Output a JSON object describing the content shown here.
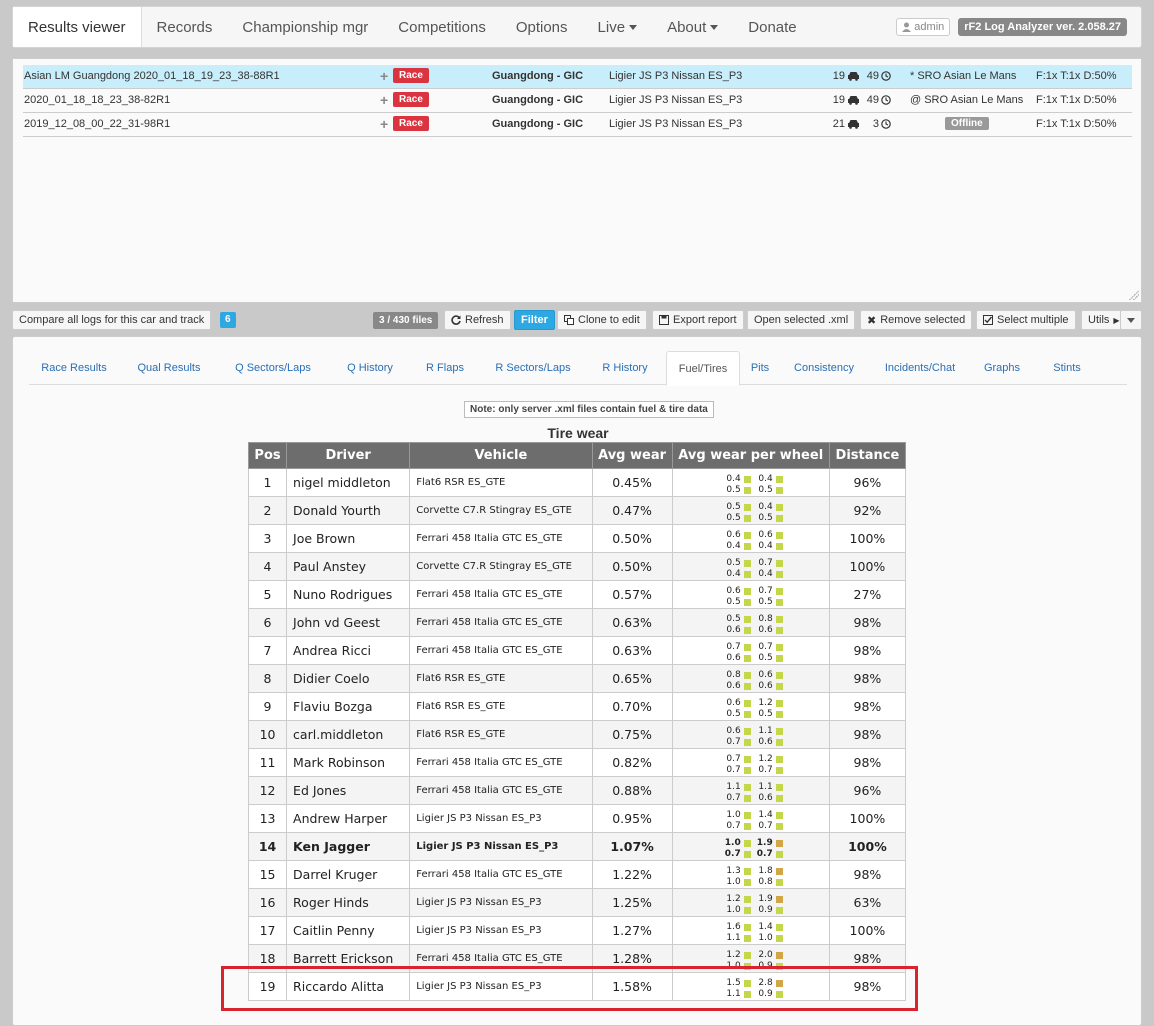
{
  "nav": {
    "items": [
      {
        "label": "Results viewer",
        "active": true
      },
      {
        "label": "Records"
      },
      {
        "label": "Championship mgr"
      },
      {
        "label": "Competitions"
      },
      {
        "label": "Options"
      },
      {
        "label": "Live",
        "dropdown": true
      },
      {
        "label": "About",
        "dropdown": true
      },
      {
        "label": "Donate"
      }
    ],
    "user": "admin",
    "version": "rF2 Log Analyzer ver. 2.058.27"
  },
  "files": [
    {
      "name": "Asian LM Guangdong 2020_01_18_19_23_38-88R1",
      "session": "Race",
      "track": "Guangdong - GIC",
      "car": "Ligier JS P3 Nissan ES_P3",
      "drivers": "19",
      "laps": "49",
      "server": "* SRO Asian Le Mans",
      "flags": "F:1x T:1x D:50%",
      "selected": true
    },
    {
      "name": "2020_01_18_18_23_38-82R1",
      "session": "Race",
      "track": "Guangdong - GIC",
      "car": "Ligier JS P3 Nissan ES_P3",
      "drivers": "19",
      "laps": "49",
      "server": "@ SRO Asian Le Mans",
      "flags": "F:1x T:1x D:50%"
    },
    {
      "name": "2019_12_08_00_22_31-98R1",
      "session": "Race",
      "track": "Guangdong - GIC",
      "car": "Ligier JS P3 Nissan ES_P3",
      "drivers": "21",
      "laps": "3",
      "server": "Offline",
      "flags": "F:1x T:1x D:50%",
      "offline": true
    }
  ],
  "toolbar": {
    "compare": "Compare all logs for this car and track",
    "compare_count": "6",
    "file_count": "3 / 430 files",
    "refresh": "Refresh",
    "filter": "Filter",
    "clone": "Clone to edit",
    "export": "Export report",
    "open_xml": "Open selected .xml",
    "remove": "Remove selected",
    "select_multiple": "Select multiple",
    "utils": "Utils"
  },
  "tabs": [
    {
      "label": "Race Results"
    },
    {
      "label": "Qual Results"
    },
    {
      "label": "Q Sectors/Laps"
    },
    {
      "label": "Q History"
    },
    {
      "label": "R Flaps"
    },
    {
      "label": "R Sectors/Laps"
    },
    {
      "label": "R History"
    },
    {
      "label": "Fuel/Tires",
      "active": true
    },
    {
      "label": "Pits"
    },
    {
      "label": "Consistency"
    },
    {
      "label": "Incidents/Chat"
    },
    {
      "label": "Graphs"
    },
    {
      "label": "Stints"
    }
  ],
  "note": "Note: only server .xml files contain fuel & tire data",
  "table": {
    "title": "Tire wear",
    "headers": [
      "Pos",
      "Driver",
      "Vehicle",
      "Avg wear",
      "Avg wear per wheel",
      "Distance"
    ],
    "rows": [
      {
        "pos": "1",
        "driver": "nigel middleton",
        "vehicle": "Flat6 RSR ES_GTE",
        "avg": "0.45%",
        "w": [
          "0.4",
          "0.4",
          "0.5",
          "0.5"
        ],
        "dist": "96%"
      },
      {
        "pos": "2",
        "driver": "Donald Yourth",
        "vehicle": "Corvette C7.R Stingray ES_GTE",
        "avg": "0.47%",
        "w": [
          "0.5",
          "0.4",
          "0.5",
          "0.5"
        ],
        "dist": "92%"
      },
      {
        "pos": "3",
        "driver": "Joe Brown",
        "vehicle": "Ferrari 458 Italia GTC ES_GTE",
        "avg": "0.50%",
        "w": [
          "0.6",
          "0.6",
          "0.4",
          "0.4"
        ],
        "dist": "100%"
      },
      {
        "pos": "4",
        "driver": "Paul Anstey",
        "vehicle": "Corvette C7.R Stingray ES_GTE",
        "avg": "0.50%",
        "w": [
          "0.5",
          "0.7",
          "0.4",
          "0.4"
        ],
        "dist": "100%"
      },
      {
        "pos": "5",
        "driver": "Nuno Rodrigues",
        "vehicle": "Ferrari 458 Italia GTC ES_GTE",
        "avg": "0.57%",
        "w": [
          "0.6",
          "0.7",
          "0.5",
          "0.5"
        ],
        "dist": "27%"
      },
      {
        "pos": "6",
        "driver": "John vd Geest",
        "vehicle": "Ferrari 458 Italia GTC ES_GTE",
        "avg": "0.63%",
        "w": [
          "0.5",
          "0.8",
          "0.6",
          "0.6"
        ],
        "dist": "98%"
      },
      {
        "pos": "7",
        "driver": "Andrea Ricci",
        "vehicle": "Ferrari 458 Italia GTC ES_GTE",
        "avg": "0.63%",
        "w": [
          "0.7",
          "0.7",
          "0.6",
          "0.5"
        ],
        "dist": "98%"
      },
      {
        "pos": "8",
        "driver": "Didier Coelo",
        "vehicle": "Flat6 RSR ES_GTE",
        "avg": "0.65%",
        "w": [
          "0.8",
          "0.6",
          "0.6",
          "0.6"
        ],
        "dist": "98%"
      },
      {
        "pos": "9",
        "driver": "Flaviu Bozga",
        "vehicle": "Flat6 RSR ES_GTE",
        "avg": "0.70%",
        "w": [
          "0.6",
          "1.2",
          "0.5",
          "0.5"
        ],
        "dist": "98%"
      },
      {
        "pos": "10",
        "driver": "carl.middleton",
        "vehicle": "Flat6 RSR ES_GTE",
        "avg": "0.75%",
        "w": [
          "0.6",
          "1.1",
          "0.7",
          "0.6"
        ],
        "dist": "98%"
      },
      {
        "pos": "11",
        "driver": "Mark Robinson",
        "vehicle": "Ferrari 458 Italia GTC ES_GTE",
        "avg": "0.82%",
        "w": [
          "0.7",
          "1.2",
          "0.7",
          "0.7"
        ],
        "dist": "98%"
      },
      {
        "pos": "12",
        "driver": "Ed Jones",
        "vehicle": "Ferrari 458 Italia GTC ES_GTE",
        "avg": "0.88%",
        "w": [
          "1.1",
          "1.1",
          "0.7",
          "0.6"
        ],
        "dist": "96%"
      },
      {
        "pos": "13",
        "driver": "Andrew Harper",
        "vehicle": "Ligier JS P3 Nissan ES_P3",
        "avg": "0.95%",
        "w": [
          "1.0",
          "1.4",
          "0.7",
          "0.7"
        ],
        "dist": "100%"
      },
      {
        "pos": "14",
        "driver": "Ken Jagger",
        "vehicle": "Ligier JS P3 Nissan ES_P3",
        "avg": "1.07%",
        "w": [
          "1.0",
          "1.9",
          "0.7",
          "0.7"
        ],
        "dist": "100%",
        "bold": true
      },
      {
        "pos": "15",
        "driver": "Darrel Kruger",
        "vehicle": "Ferrari 458 Italia GTC ES_GTE",
        "avg": "1.22%",
        "w": [
          "1.3",
          "1.8",
          "1.0",
          "0.8"
        ],
        "dist": "98%"
      },
      {
        "pos": "16",
        "driver": "Roger Hinds",
        "vehicle": "Ligier JS P3 Nissan ES_P3",
        "avg": "1.25%",
        "w": [
          "1.2",
          "1.9",
          "1.0",
          "0.9"
        ],
        "dist": "63%"
      },
      {
        "pos": "17",
        "driver": "Caitlin Penny",
        "vehicle": "Ligier JS P3 Nissan ES_P3",
        "avg": "1.27%",
        "w": [
          "1.6",
          "1.4",
          "1.1",
          "1.0"
        ],
        "dist": "100%"
      },
      {
        "pos": "18",
        "driver": "Barrett Erickson",
        "vehicle": "Ferrari 458 Italia GTC ES_GTE",
        "avg": "1.28%",
        "w": [
          "1.2",
          "2.0",
          "1.0",
          "0.9"
        ],
        "dist": "98%"
      },
      {
        "pos": "19",
        "driver": "Riccardo Alitta",
        "vehicle": "Ligier JS P3 Nissan ES_P3",
        "avg": "1.58%",
        "w": [
          "1.5",
          "2.8",
          "1.1",
          "0.9"
        ],
        "dist": "98%"
      }
    ]
  },
  "colors": {
    "wear_low": "#c4d64a",
    "wear_high": "#d1a647",
    "highlight": "#d9232e"
  }
}
